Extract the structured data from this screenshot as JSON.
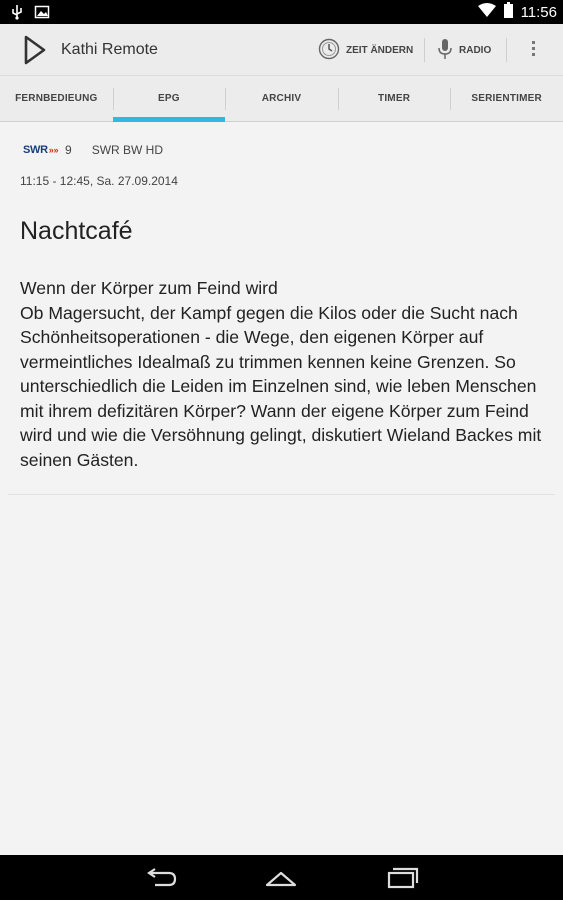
{
  "status_bar": {
    "time": "11:56",
    "left_icons": [
      "usb-icon",
      "image-icon"
    ],
    "right_icons": [
      "wifi-icon",
      "battery-icon"
    ]
  },
  "action_bar": {
    "app_title": "Kathi Remote",
    "zeit_label": "ZEIT ÄNDERN",
    "radio_label": "RADIO"
  },
  "tabs": [
    {
      "label": "FERNBEDIEUNG",
      "active": false
    },
    {
      "label": "EPG",
      "active": true
    },
    {
      "label": "ARCHIV",
      "active": false
    },
    {
      "label": "TIMER",
      "active": false
    },
    {
      "label": "SERIENTIMER",
      "active": false
    }
  ],
  "program": {
    "channel_logo_text": "SWR",
    "channel_number": "9",
    "channel_name": "SWR BW HD",
    "time": "11:15 - 12:45, Sa. 27.09.2014",
    "title": "Nachtcafé",
    "description": "Wenn der Körper zum Feind wird\nOb Magersucht, der Kampf gegen die Kilos oder die Sucht nach Schönheitsoperationen - die Wege, den eigenen Körper auf vermeintliches Idealmaß zu trimmen kennen keine Grenzen. So unterschiedlich die Leiden im Einzelnen sind, wie leben Menschen mit ihrem defizitären Körper? Wann der eigene Körper zum Feind wird und wie die Versöhnung gelingt, diskutiert Wieland Backes mit seinen Gästen."
  },
  "colors": {
    "accent": "#33b5e5",
    "swr_blue": "#1b3e7a",
    "swr_red": "#e2231a"
  },
  "nav_icons": [
    "back-icon",
    "home-icon",
    "recents-icon"
  ]
}
